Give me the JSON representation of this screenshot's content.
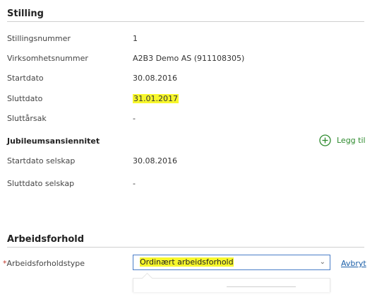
{
  "stilling": {
    "title": "Stilling",
    "rows": [
      {
        "label": "Stillingsnummer",
        "value": "1",
        "highlight": false
      },
      {
        "label": "Virksomhetsnummer",
        "value": "A2B3 Demo AS (911108305)",
        "highlight": false
      },
      {
        "label": "Startdato",
        "value": "30.08.2016",
        "highlight": false
      },
      {
        "label": "Sluttdato",
        "value": "31.01.2017",
        "highlight": true
      },
      {
        "label": "Sluttårsak",
        "value": "-",
        "highlight": false
      }
    ]
  },
  "jubileum": {
    "title": "Jubileumsansiennitet",
    "add_label": "Legg til",
    "add_icon": "plus-circle-icon",
    "rows": [
      {
        "label": "Startdato selskap",
        "value": "30.08.2016"
      },
      {
        "label": "Sluttdato selskap",
        "value": "-"
      }
    ]
  },
  "arbeidsforhold": {
    "title": "Arbeidsforhold",
    "required_marker": "*",
    "type_label": "Arbeidsforholdstype",
    "type_value": "Ordinært arbeidsforhold",
    "chevron_icon": "chevron-down-icon",
    "cancel_label": "Avbryt"
  },
  "colors": {
    "highlight": "#f7f72c",
    "accent_green": "#2d8a2d",
    "link_blue": "#1a5ea8",
    "input_border": "#4a7ec8"
  }
}
